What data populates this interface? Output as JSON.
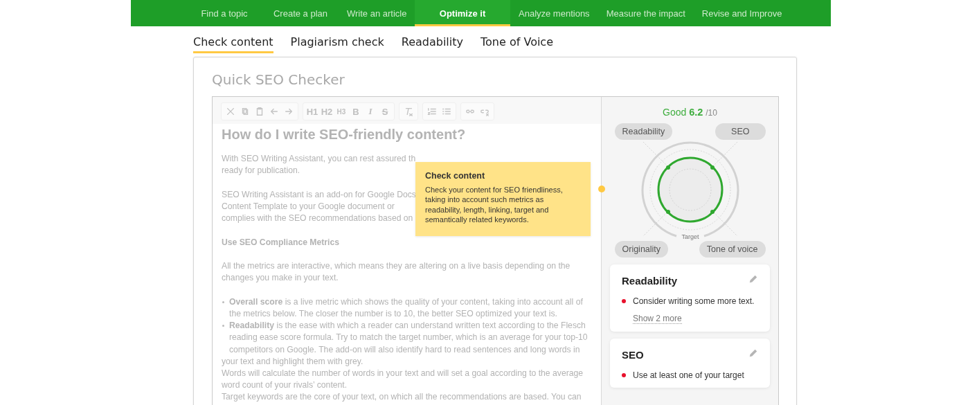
{
  "nav": [
    {
      "label": "Find a topic",
      "selected": false
    },
    {
      "label": "Create a plan",
      "selected": false
    },
    {
      "label": "Write an article",
      "selected": false
    },
    {
      "label": "Optimize it",
      "selected": true
    },
    {
      "label": "Analyze mentions",
      "selected": false
    },
    {
      "label": "Measure the impact",
      "selected": false
    },
    {
      "label": "Revise and Improve",
      "selected": false
    }
  ],
  "tabs": [
    {
      "label": "Check content",
      "selected": true
    },
    {
      "label": "Plagiarism check",
      "selected": false
    },
    {
      "label": "Readability",
      "selected": false
    },
    {
      "label": "Tone of Voice",
      "selected": false
    }
  ],
  "card_title": "Quick SEO Checker",
  "format_buttons": [
    "H1",
    "H2",
    "H3",
    "B",
    "I",
    "S"
  ],
  "editor": {
    "heading": "How do I write SEO-friendly content?",
    "blocks": [
      {
        "kind": "para",
        "lines": [
          "With SEO Writing Assistant, you can rest assured th",
          "ready for publication."
        ]
      },
      {
        "kind": "para",
        "lines": [
          "SEO Writing Assistant is an add-on for Google Docs",
          "Content Template to your Google document or",
          "complies with the SEO recommendations based on"
        ]
      },
      {
        "kind": "subheading",
        "lines": [
          "Use SEO Compliance Metrics"
        ]
      },
      {
        "kind": "para",
        "lines": [
          "All the metrics are interactive, which means they are altering on a live basis depending on the",
          "changes you make in your text."
        ]
      },
      {
        "kind": "bullet",
        "lines": [
          "**Overall score** is a live metric which shows the quality of your content, taking into account all of",
          "the metrics below. The closer the number is to 10, the better SEO optimized your text is."
        ]
      },
      {
        "kind": "bullet",
        "lines": [
          "**Readability** is the ease with which a reader can understand written text according to the Flesch",
          "reading ease score formula. Try to match the target number, which is an average for your top-10",
          "competitors on Google. The add-on will also identify hard to read sentences and long words in"
        ]
      },
      {
        "kind": "line",
        "lines": [
          "your text and highlight them with grey."
        ]
      },
      {
        "kind": "line",
        "lines": [
          "Words will calculate the number of words in your text and will set a goal according to the average",
          "word count of your rivals’ content."
        ]
      },
      {
        "kind": "line",
        "lines": [
          "Target keywords are the core of your text, on which all the recommendations are based. You can"
        ]
      }
    ]
  },
  "tooltip": {
    "title": "Check content",
    "text": "Check your content for SEO friendliness, taking into account such metrics as readability, length, linking, target and semantically related keywords."
  },
  "score": {
    "label": "Good",
    "value": "6.2",
    "max": "/10"
  },
  "radar": {
    "labels": [
      "Readability",
      "SEO",
      "Originality",
      "Tone of voice"
    ],
    "target_label": "Target"
  },
  "panels": [
    {
      "title": "Readability",
      "items": [
        {
          "text": "Consider writing some more text.",
          "color": "#e8112d"
        }
      ],
      "more": "Show 2 more"
    },
    {
      "title": "SEO",
      "items": [
        {
          "text": "Use at least one of your target",
          "color": "#e8112d"
        }
      ]
    }
  ]
}
